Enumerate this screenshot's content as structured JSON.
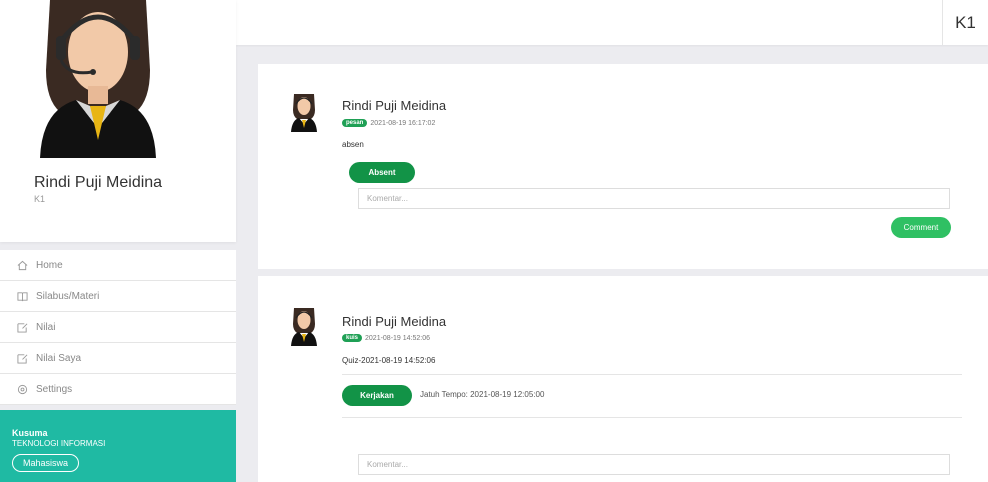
{
  "topbar": {
    "title": "K1"
  },
  "profile": {
    "name": "Rindi Puji Meidina",
    "class": "K1",
    "avatar_icon": "operator-avatar-icon"
  },
  "menu": [
    {
      "label": "Home",
      "icon": "home-icon"
    },
    {
      "label": "Silabus/Materi",
      "icon": "book-icon"
    },
    {
      "label": "Nilai",
      "icon": "edit-box-icon"
    },
    {
      "label": "Nilai Saya",
      "icon": "edit-box-icon"
    },
    {
      "label": "Settings",
      "icon": "gear-icon"
    }
  ],
  "user_box": {
    "name": "Kusuma",
    "department": "TEKNOLOGI INFORMASI",
    "role": "Mahasiswa",
    "color": "#1fbaa3"
  },
  "posts": [
    {
      "author": "Rindi Puji Meidina",
      "tag": "pesan",
      "timestamp": "2021-08-19 16:17:02",
      "body": "absen",
      "action_label": "Absent",
      "comment_placeholder": "Komentar...",
      "comment_button": "Comment"
    },
    {
      "author": "Rindi Puji Meidina",
      "tag": "kuis",
      "timestamp": "2021-08-19 14:52:06",
      "body": "Quiz-2021-08-19 14:52:06",
      "action_label": "Kerjakan",
      "due": "Jatuh Tempo: 2021-08-19 12:05:00",
      "comment_placeholder": "Komentar..."
    }
  ],
  "colors": {
    "accent_green": "#129347",
    "tag_green": "#1fa055",
    "comment_green": "#2fc063",
    "teal": "#1fbaa3"
  }
}
